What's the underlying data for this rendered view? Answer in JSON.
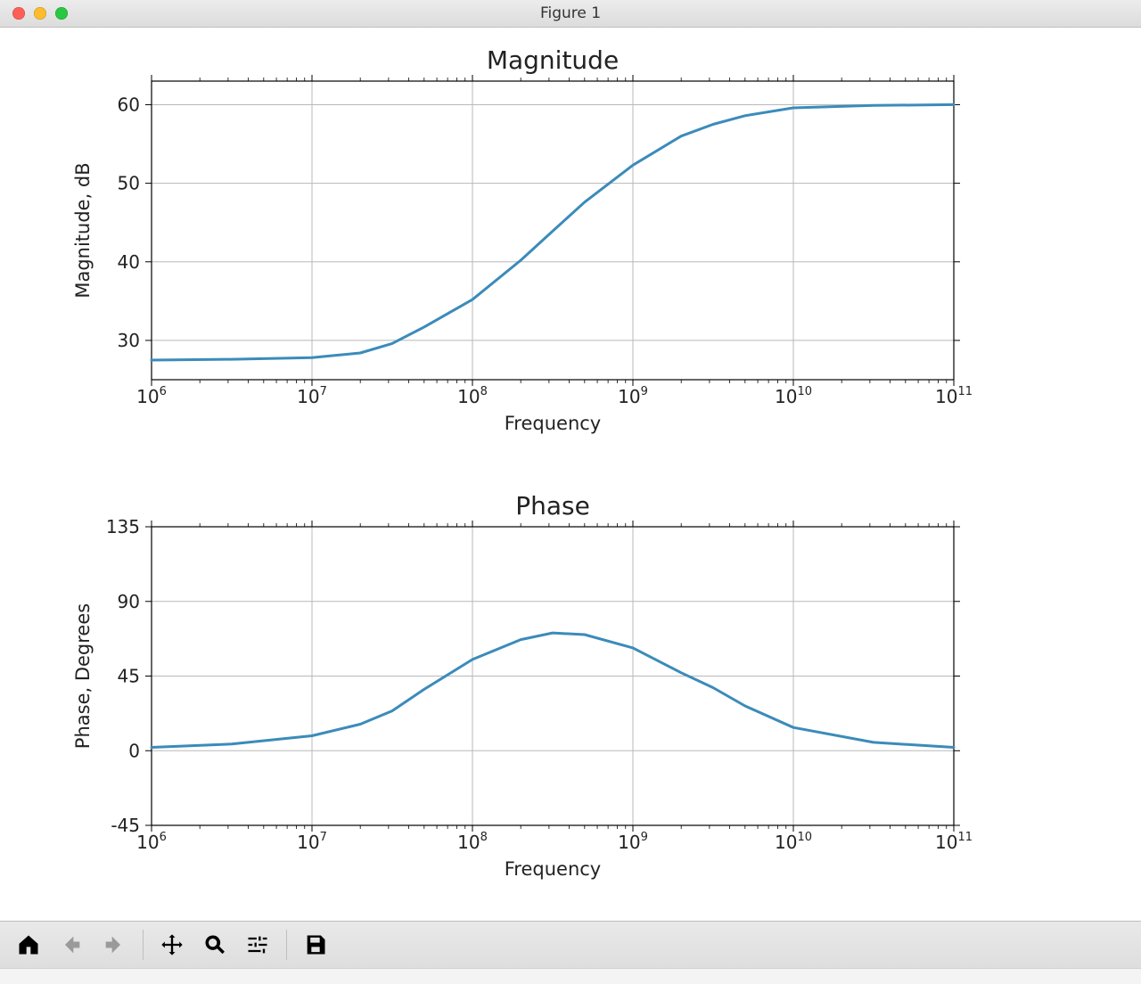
{
  "window": {
    "title": "Figure 1"
  },
  "toolbar": {
    "home": "Home",
    "back": "Back",
    "forward": "Forward",
    "pan": "Pan",
    "zoom": "Zoom",
    "configure": "Configure subplots",
    "save": "Save"
  },
  "chart_data": [
    {
      "type": "line",
      "title": "Magnitude",
      "xlabel": "Frequency",
      "ylabel": "Magnitude, dB",
      "xscale": "log",
      "xlim": [
        1000000.0,
        100000000000.0
      ],
      "ylim": [
        25,
        63
      ],
      "xticks": [
        1000000.0,
        10000000.0,
        100000000.0,
        1000000000.0,
        10000000000.0,
        100000000000.0
      ],
      "xtick_labels": [
        "10^6",
        "10^7",
        "10^8",
        "10^9",
        "10^10",
        "10^11"
      ],
      "yticks": [
        30,
        40,
        50,
        60
      ],
      "grid": true,
      "series": [
        {
          "name": "magnitude",
          "color": "#3b8bba",
          "x": [
            1000000.0,
            3160000.0,
            10000000.0,
            20000000.0,
            31600000.0,
            50000000.0,
            100000000.0,
            200000000.0,
            316000000.0,
            500000000.0,
            1000000000.0,
            2000000000.0,
            3160000000.0,
            5000000000.0,
            10000000000.0,
            31600000000.0,
            100000000000.0
          ],
          "y": [
            27.5,
            27.6,
            27.8,
            28.4,
            29.6,
            31.7,
            35.2,
            40.2,
            43.9,
            47.6,
            52.3,
            56.0,
            57.5,
            58.6,
            59.6,
            59.9,
            60.0
          ]
        }
      ]
    },
    {
      "type": "line",
      "title": "Phase",
      "xlabel": "Frequency",
      "ylabel": "Phase, Degrees",
      "xscale": "log",
      "xlim": [
        1000000.0,
        100000000000.0
      ],
      "ylim": [
        -45,
        135
      ],
      "xticks": [
        1000000.0,
        10000000.0,
        100000000.0,
        1000000000.0,
        10000000000.0,
        100000000000.0
      ],
      "xtick_labels": [
        "10^6",
        "10^7",
        "10^8",
        "10^9",
        "10^10",
        "10^11"
      ],
      "yticks": [
        -45,
        0,
        45,
        90,
        135
      ],
      "grid": true,
      "series": [
        {
          "name": "phase",
          "color": "#3b8bba",
          "x": [
            1000000.0,
            3160000.0,
            10000000.0,
            20000000.0,
            31600000.0,
            50000000.0,
            100000000.0,
            200000000.0,
            316000000.0,
            500000000.0,
            1000000000.0,
            2000000000.0,
            3160000000.0,
            5000000000.0,
            10000000000.0,
            31600000000.0,
            100000000000.0
          ],
          "y": [
            2.0,
            4.0,
            9.0,
            16.0,
            24.0,
            37.0,
            55.0,
            67.0,
            71.0,
            70.0,
            62.0,
            47.0,
            38.0,
            27.0,
            14.0,
            5.0,
            2.0
          ]
        }
      ]
    }
  ]
}
